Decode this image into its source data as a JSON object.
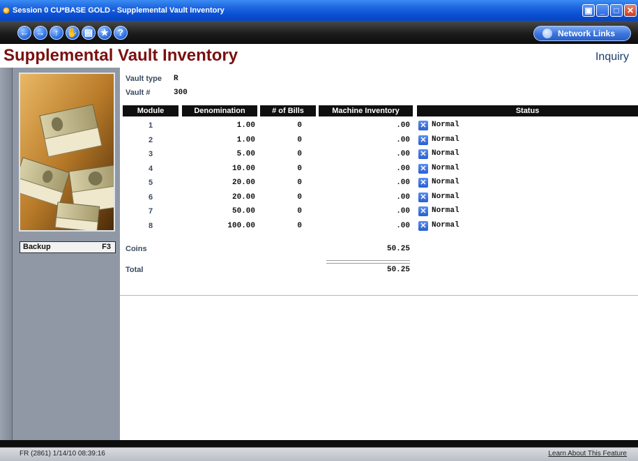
{
  "window": {
    "title": "Session 0 CU*BASE GOLD - Supplemental Vault Inventory"
  },
  "nav": {
    "buttons": [
      {
        "name": "back-icon",
        "glyph": "←"
      },
      {
        "name": "forward-icon",
        "glyph": "→"
      },
      {
        "name": "up-icon",
        "glyph": "↑"
      },
      {
        "name": "stop-hand-icon",
        "glyph": "✋"
      },
      {
        "name": "print-icon",
        "glyph": "▤"
      },
      {
        "name": "favorites-star-icon",
        "glyph": "★"
      },
      {
        "name": "help-icon",
        "glyph": "?"
      }
    ],
    "network_links": "Network Links"
  },
  "header": {
    "title": "Supplemental Vault Inventory",
    "mode": "Inquiry"
  },
  "sidebar": {
    "backup_label": "Backup",
    "backup_key": "F3"
  },
  "vault": {
    "type_label": "Vault type",
    "type_value": "R",
    "number_label": "Vault #",
    "number_value": "300"
  },
  "table": {
    "headers": [
      "Module",
      "Denomination",
      "# of Bills",
      "Machine Inventory",
      "Status"
    ],
    "rows": [
      {
        "module": "1",
        "denomination": "1.00",
        "bills": "0",
        "machine": ".00",
        "status": "Normal"
      },
      {
        "module": "2",
        "denomination": "1.00",
        "bills": "0",
        "machine": ".00",
        "status": "Normal"
      },
      {
        "module": "3",
        "denomination": "5.00",
        "bills": "0",
        "machine": ".00",
        "status": "Normal"
      },
      {
        "module": "4",
        "denomination": "10.00",
        "bills": "0",
        "machine": ".00",
        "status": "Normal"
      },
      {
        "module": "5",
        "denomination": "20.00",
        "bills": "0",
        "machine": ".00",
        "status": "Normal"
      },
      {
        "module": "6",
        "denomination": "20.00",
        "bills": "0",
        "machine": ".00",
        "status": "Normal"
      },
      {
        "module": "7",
        "denomination": "50.00",
        "bills": "0",
        "machine": ".00",
        "status": "Normal"
      },
      {
        "module": "8",
        "denomination": "100.00",
        "bills": "0",
        "machine": ".00",
        "status": "Normal"
      }
    ]
  },
  "totals": {
    "coins_label": "Coins",
    "coins_value": "50.25",
    "total_label": "Total",
    "total_value": "50.25"
  },
  "statusbar": {
    "left": "FR (2861) 1/14/10 08:39:16",
    "right": "Learn About This Feature"
  },
  "colors": {
    "title_red": "#7a1010",
    "titlebar_blue": "#0a4fd4",
    "nav_black": "#1c1c1c"
  }
}
